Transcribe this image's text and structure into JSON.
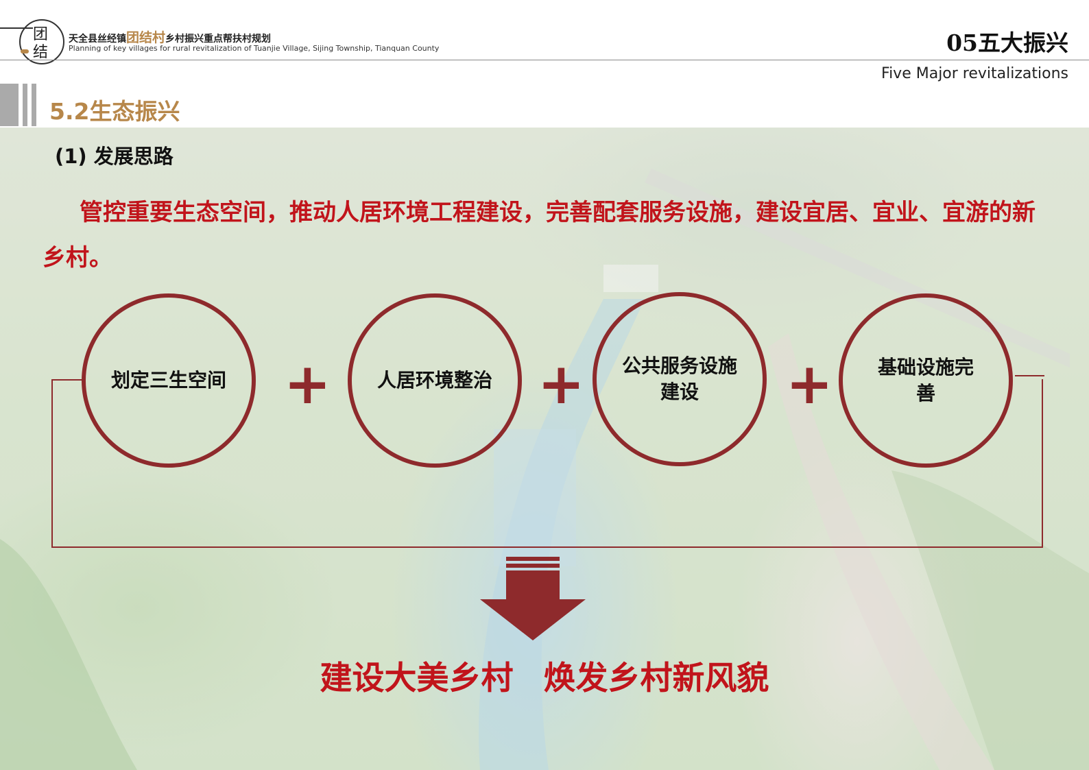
{
  "header": {
    "logo_chars": [
      "团",
      "结"
    ],
    "title_prefix": "天全县丝经镇",
    "title_highlight": "团结村",
    "title_suffix": "乡村振兴重点帮扶村规划",
    "subtitle": "Planning of key villages for rural revitalization of Tuanjie Village, Sijing Township, Tianquan County",
    "chapter": "05五大振兴",
    "chapter_en": "Five Major revitalizations"
  },
  "section": {
    "title": "5.2生态振兴",
    "sub_heading": "(1) 发展思路",
    "lead_text": "管控重要生态空间，推动人居环境工程建设，完善配套服务设施，建设宜居、宜业、宜游的新乡村。"
  },
  "circles": [
    {
      "label": "划定三生空间"
    },
    {
      "label": "人居环境整治"
    },
    {
      "label": "公共服务设施\n建设"
    },
    {
      "label": "基础设施完\n善"
    }
  ],
  "plus_symbol": "+",
  "slogan": {
    "part1": "建设大美乡村",
    "part2": "焕发乡村新风貌"
  },
  "colors": {
    "accent_gold": "#b7874a",
    "accent_red": "#c1141b",
    "frame_maroon": "#8e2a2c"
  },
  "icons": [
    "down-arrow-icon"
  ]
}
